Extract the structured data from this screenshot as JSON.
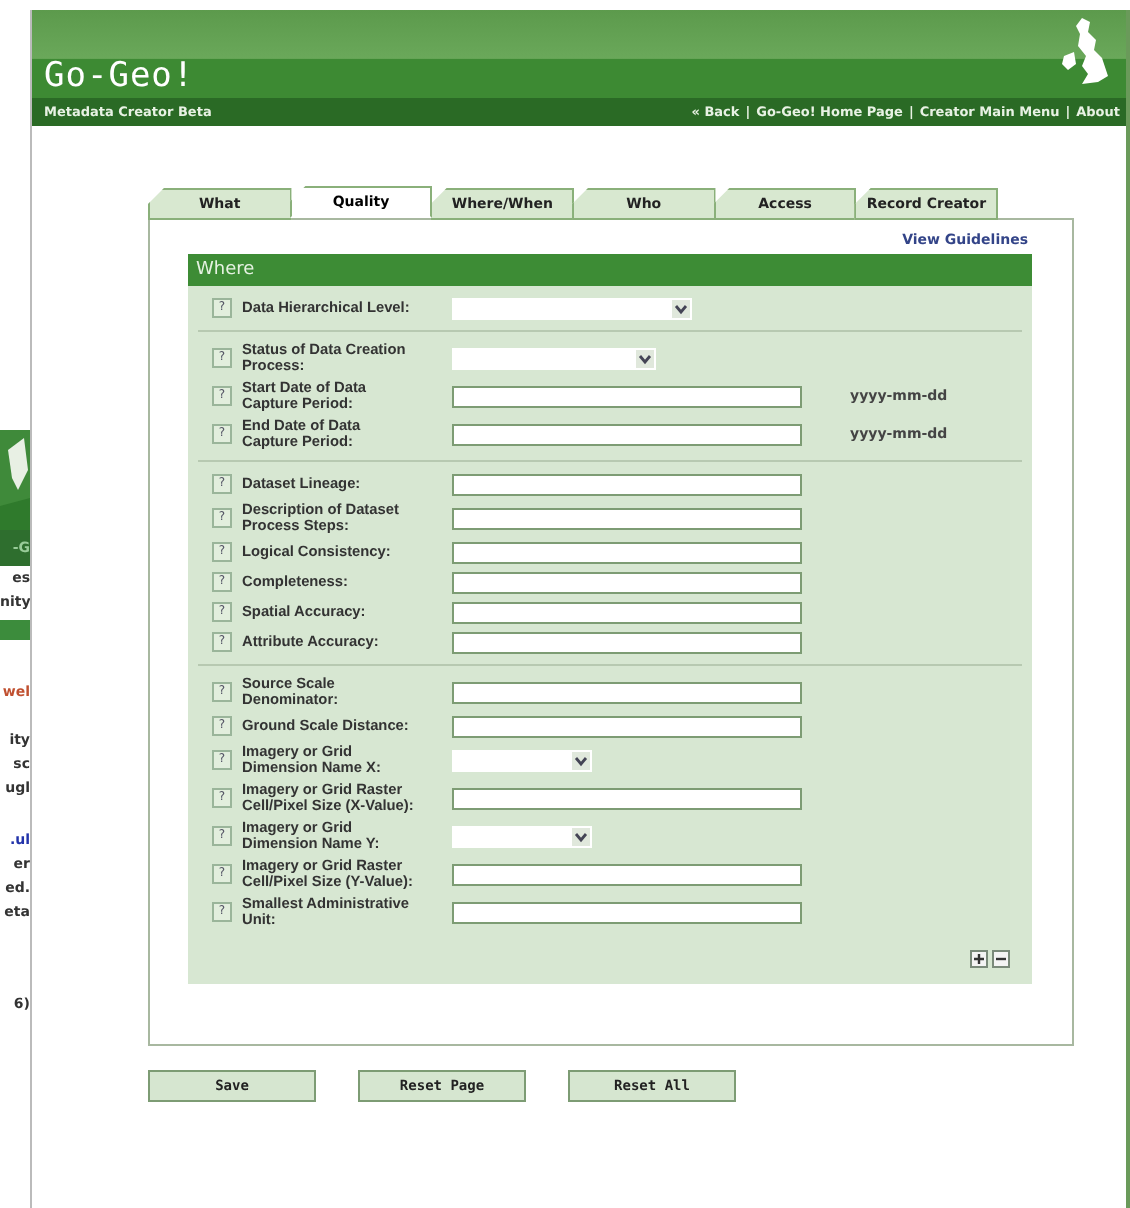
{
  "background_window": {
    "brand": "-G",
    "intro": [
      "es",
      "nity"
    ],
    "heading": "wel",
    "paragraph": [
      "ity",
      "sc",
      "ugl"
    ],
    "link": ".ul",
    "paragraph_2": [
      "er",
      "ed.",
      "eta"
    ],
    "footer": "6)"
  },
  "header": {
    "title": "Go-Geo!",
    "subtitle": "Metadata Creator Beta",
    "nav_separator": "|",
    "nav": [
      "« Back",
      "Go-Geo! Home Page",
      "Creator Main Menu",
      "About"
    ]
  },
  "tabs": [
    {
      "label": "What",
      "selected": false
    },
    {
      "label": "Quality",
      "selected": true
    },
    {
      "label": "Where/When",
      "selected": false
    },
    {
      "label": "Who",
      "selected": false
    },
    {
      "label": "Access",
      "selected": false
    },
    {
      "label": "Record Creator",
      "selected": false
    }
  ],
  "guidelines_link": "View Guidelines",
  "panel": {
    "title": "Where",
    "help_mark": "?",
    "groups": [
      [
        {
          "label": "Data Hierarchical Level:",
          "kind": "select"
        }
      ],
      [
        {
          "label": "Status of Data Creation Process:",
          "kind": "select-medium"
        },
        {
          "label": "Start Date of Data Capture Period:",
          "kind": "text",
          "hint": "yyyy-mm-dd"
        },
        {
          "label": "End Date of Data Capture Period:",
          "kind": "text",
          "hint": "yyyy-mm-dd"
        }
      ],
      [
        {
          "label": "Dataset Lineage:",
          "kind": "text"
        },
        {
          "label": "Description of Dataset Process Steps:",
          "kind": "text"
        },
        {
          "label": "Logical Consistency:",
          "kind": "text"
        },
        {
          "label": "Completeness:",
          "kind": "text"
        },
        {
          "label": "Spatial Accuracy:",
          "kind": "text"
        },
        {
          "label": "Attribute Accuracy:",
          "kind": "text"
        }
      ],
      [
        {
          "label": "Source Scale Denominator:",
          "kind": "text"
        },
        {
          "label": "Ground Scale Distance:",
          "kind": "text"
        },
        {
          "label": "Imagery or Grid Dimension Name X:",
          "kind": "select-short"
        },
        {
          "label": "Imagery or Grid Raster Cell/Pixel Size (X-Value):",
          "kind": "text"
        },
        {
          "label": "Imagery or Grid Dimension Name Y:",
          "kind": "select-short"
        },
        {
          "label": "Imagery or Grid Raster Cell/Pixel Size (Y-Value):",
          "kind": "text"
        },
        {
          "label": "Smallest Administrative Unit:",
          "kind": "text"
        }
      ]
    ]
  },
  "buttons": [
    "Save",
    "Reset Page",
    "Reset All"
  ]
}
